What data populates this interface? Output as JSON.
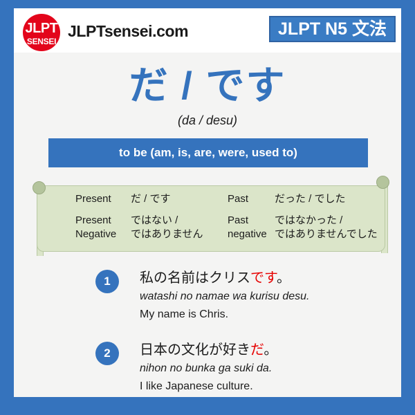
{
  "header": {
    "logo_top": "JLPT",
    "logo_bottom": "SENSEI",
    "site_name": "JLPTsensei.com",
    "level_badge": "JLPT N5 文法"
  },
  "grammar": {
    "title": "だ / です",
    "romaji": "(da / desu)",
    "meaning": "to be (am, is, are, were, used to)"
  },
  "conjugation": {
    "rows": [
      {
        "left_label": "Present",
        "left_value": "だ / です",
        "right_label": "Past",
        "right_value": "だった / でした"
      },
      {
        "left_label": "Present Negative",
        "left_value": "ではない / ではありません",
        "right_label": "Past negative",
        "right_value": "ではなかった / ではありませんでした"
      }
    ],
    "row2_left_label_line1": "Present",
    "row2_left_label_line2": "Negative",
    "row2_left_value_line1": "ではない /",
    "row2_left_value_line2": "ではありません",
    "row2_right_label_line1": "Past",
    "row2_right_label_line2": "negative",
    "row2_right_value_line1": "ではなかった /",
    "row2_right_value_line2": "ではありませんでした"
  },
  "examples": [
    {
      "number": "1",
      "jp_before": "私の名前はクリス",
      "jp_highlight": "です",
      "jp_after": "。",
      "romaji": "watashi no namae wa kurisu desu.",
      "english": "My name is Chris."
    },
    {
      "number": "2",
      "jp_before": "日本の文化が好き",
      "jp_highlight": "だ",
      "jp_after": "。",
      "romaji": "nihon no bunka ga suki da.",
      "english": "I like Japanese culture."
    }
  ],
  "colors": {
    "frame_blue": "#3573bd",
    "logo_red": "#e3051b",
    "table_green": "#dbe5c9",
    "highlight_red": "#e60000"
  }
}
